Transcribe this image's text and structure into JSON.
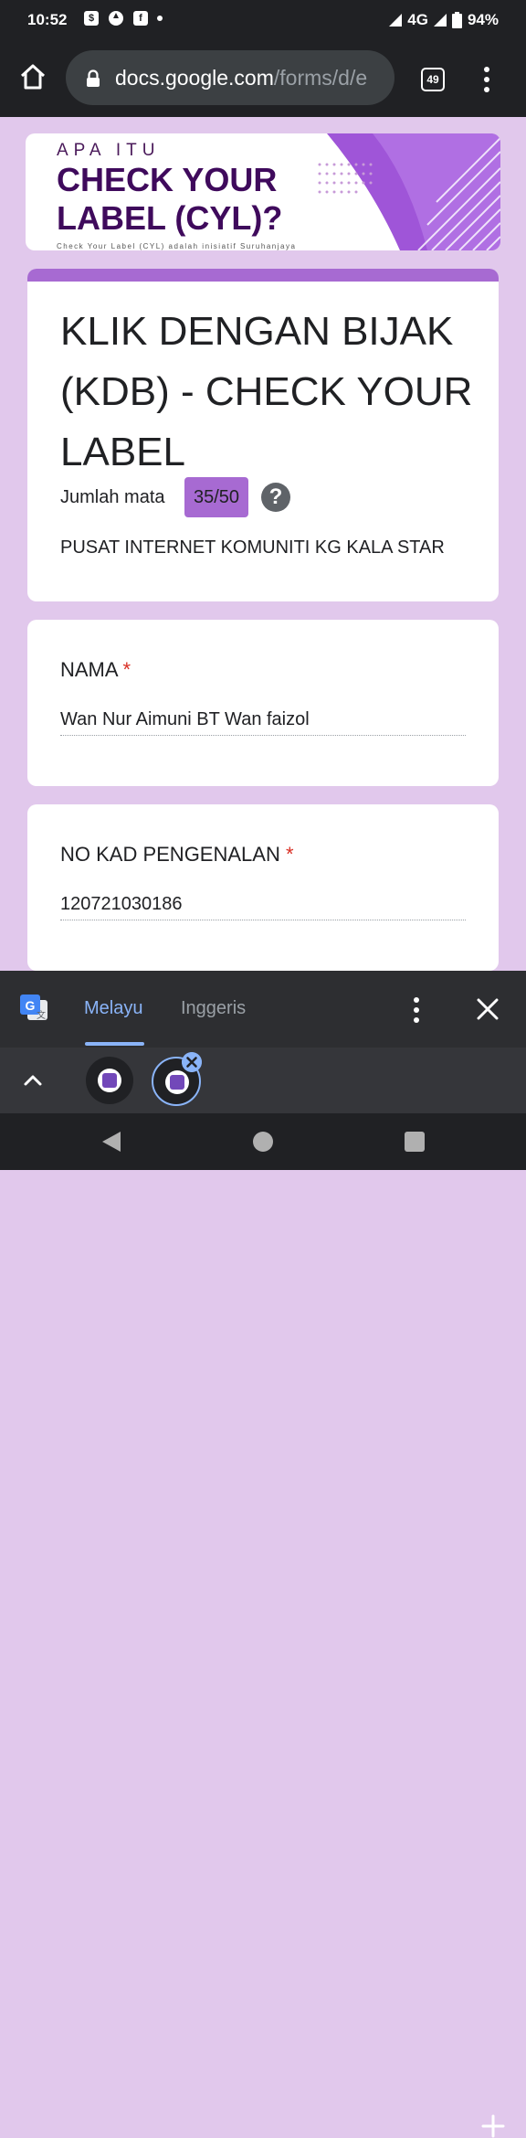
{
  "status_bar": {
    "time": "10:52",
    "network": "4G",
    "battery": "94%",
    "icons": [
      "shop-icon",
      "camera-icon",
      "facebook-icon",
      "dot-icon",
      "signal-icon",
      "battery-icon"
    ]
  },
  "browser": {
    "url_domain": "docs.google.com",
    "url_path": "/forms/d/e",
    "tab_count": "49"
  },
  "banner": {
    "line1": "APA ITU",
    "line2": "CHECK YOUR",
    "line3": "LABEL (CYL)?",
    "small_text": "Check Your Label (CYL) adalah inisiatif Suruhanjaya"
  },
  "form": {
    "title": "KLIK DENGAN BIJAK (KDB) - CHECK YOUR LABEL",
    "score_label": "Jumlah mata",
    "score": "35/50",
    "help_symbol": "?",
    "organization": "PUSAT INTERNET KOMUNITI KG KALA STAR",
    "questions": [
      {
        "label": "NAMA",
        "required_mark": "*",
        "value": "Wan Nur Aimuni BT Wan faizol"
      },
      {
        "label": "NO KAD PENGENALAN",
        "required_mark": "*",
        "value": "120721030186"
      }
    ]
  },
  "translate_bar": {
    "source_lang": "Melayu",
    "target_lang": "Inggeris"
  },
  "colors": {
    "page_bg": "#e1c8ec",
    "accent": "#a76ad2",
    "active_tab": "#8ab4f8"
  }
}
